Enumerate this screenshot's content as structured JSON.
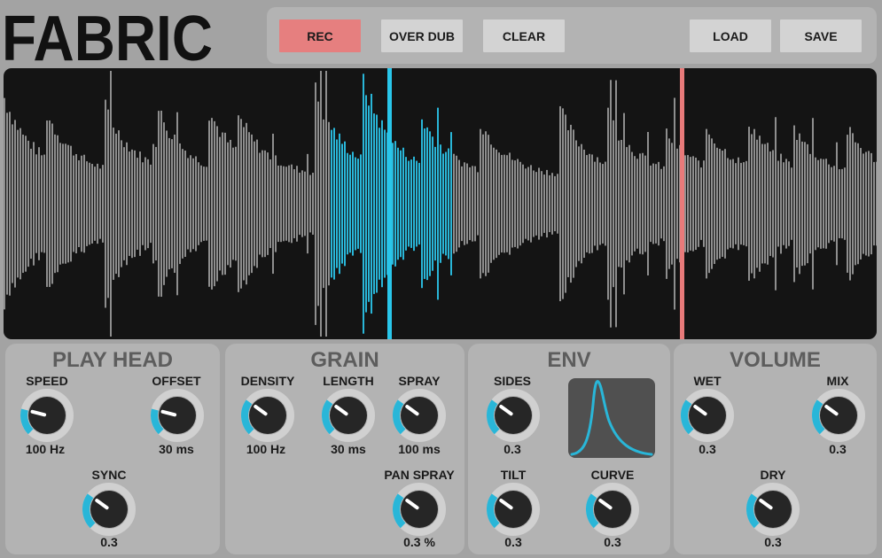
{
  "app": {
    "title": "FABRIC"
  },
  "colors": {
    "accent": "#29b6d8",
    "rec": "#e67f7f",
    "playhead": "#29c6ea",
    "marker": "#e87a7a",
    "waveform": "#8e8e8e"
  },
  "toolbar": {
    "rec_label": "REC",
    "overdub_label": "OVER DUB",
    "clear_label": "CLEAR",
    "load_label": "LOAD",
    "save_label": "SAVE"
  },
  "sections": {
    "playhead": {
      "title": "PLAY HEAD",
      "speed": {
        "label": "SPEED",
        "value": "100 Hz",
        "level": 0.22
      },
      "offset": {
        "label": "OFFSET",
        "value": "30 ms",
        "level": 0.22
      },
      "sync": {
        "label": "SYNC",
        "value": "0.3",
        "level": 0.3
      }
    },
    "grain": {
      "title": "GRAIN",
      "density": {
        "label": "DENSITY",
        "value": "100 Hz",
        "level": 0.3
      },
      "length": {
        "label": "LENGTH",
        "value": "30 ms",
        "level": 0.3
      },
      "spray": {
        "label": "SPRAY",
        "value": "100 ms",
        "level": 0.3
      },
      "panspray": {
        "label": "PAN SPRAY",
        "value": "0.3 %",
        "level": 0.3
      }
    },
    "env": {
      "title": "ENV",
      "sides": {
        "label": "SIDES",
        "value": "0.3",
        "level": 0.3
      },
      "tilt": {
        "label": "TILT",
        "value": "0.3",
        "level": 0.3
      },
      "curve": {
        "label": "CURVE",
        "value": "0.3",
        "level": 0.3
      }
    },
    "volume": {
      "title": "VOLUME",
      "wet": {
        "label": "WET",
        "value": "0.3",
        "level": 0.3
      },
      "mix": {
        "label": "MIX",
        "value": "0.3",
        "level": 0.3
      },
      "dry": {
        "label": "DRY",
        "value": "0.3",
        "level": 0.3
      }
    }
  }
}
